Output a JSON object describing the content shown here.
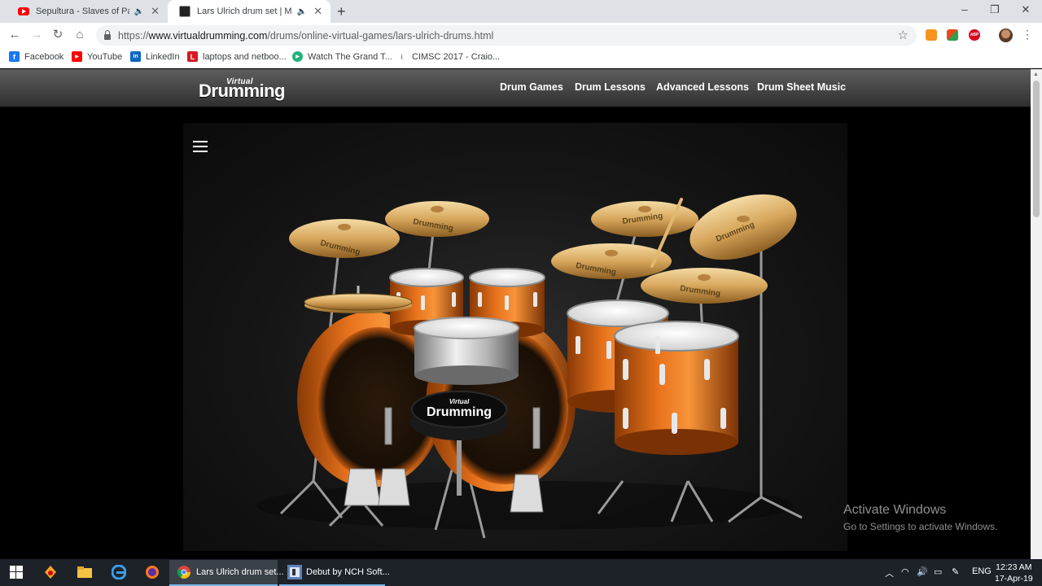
{
  "browser": {
    "tabs": [
      {
        "title": "Sepultura - Slaves of Pain - Y",
        "audio": "🔈",
        "close": "✕"
      },
      {
        "title": "Lars Ulrich drum set | Metalli",
        "audio": "🔈",
        "close": "✕"
      }
    ],
    "new_tab": "+",
    "window": {
      "minimize": "–",
      "restore": "❐",
      "close": "✕"
    },
    "nav": {
      "back": "←",
      "forward": "→",
      "reload": "↻",
      "home": "⌂",
      "star": "☆",
      "menu": "⋮"
    },
    "url": {
      "scheme": "https://",
      "host": "www.virtualdrumming.com",
      "path": "/drums/online-virtual-games/lars-ulrich-drums.html"
    },
    "extensions": [
      {
        "name": "rss-icon",
        "color": "#f7931e"
      },
      {
        "name": "office-icon",
        "color": "#2e9e4f"
      },
      {
        "name": "adblock-icon",
        "label": "ABP",
        "color": "#d6001c"
      }
    ],
    "bookmarks": [
      {
        "label": "Facebook",
        "icon": "f",
        "color": "#1877f2"
      },
      {
        "label": "YouTube",
        "icon": "▶",
        "color": "#ff0000"
      },
      {
        "label": "LinkedIn",
        "icon": "in",
        "color": "#0a66c2"
      },
      {
        "label": "laptops and netboo...",
        "icon": "L",
        "color": "#d71920"
      },
      {
        "label": "Watch The Grand T...",
        "icon": "▶",
        "color": "#1fb47a"
      },
      {
        "label": "CIMSC 2017 - Craio...",
        "icon": "i",
        "color": "#6a8caf"
      }
    ]
  },
  "site": {
    "logo_small": "Virtual",
    "logo_big": "Drumming",
    "nav": [
      "Drum Games",
      "Drum Lessons",
      "Advanced Lessons",
      "Drum Sheet Music"
    ],
    "throne_text_small": "Virtual",
    "throne_text_big": "Drumming",
    "cymbal_brand": "Drumming"
  },
  "watermark": {
    "title": "Activate Windows",
    "subtitle": "Go to Settings to activate Windows."
  },
  "taskbar": {
    "apps": [
      {
        "label": "Lars Ulrich drum set...",
        "icon": "chrome-icon",
        "state": "active"
      },
      {
        "label": "Debut by NCH Soft...",
        "icon": "debut-icon",
        "state": "open"
      }
    ],
    "lang": "ENG",
    "time": "12:23 AM",
    "date": "17-Apr-19"
  }
}
